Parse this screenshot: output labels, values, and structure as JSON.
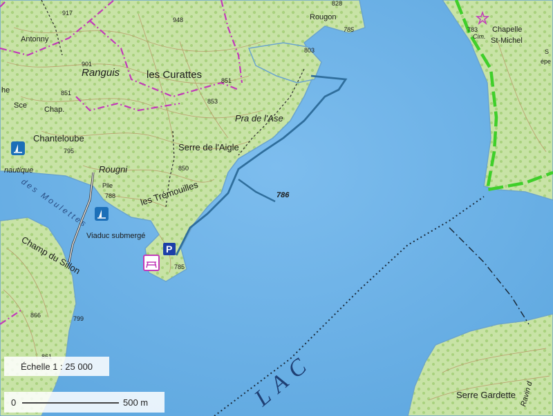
{
  "map": {
    "places": {
      "antonny": "Antonny",
      "ranguis": "Ranguis",
      "curattes": "les Curattes",
      "pra_de_lase": "Pra de l'Ase",
      "serre_aigle": "Serre de l'Aigle",
      "chanteloube": "Chanteloube",
      "rougni": "Rougni",
      "plle": "Plle",
      "tremouilles": "les Trémouilles",
      "viaduc": "Viaduc submergé",
      "champ_du_sillon": "Champ du Sillon",
      "rougon": "Rougon",
      "chap": "Chap.",
      "sce": "Sce",
      "nautique": "nautique",
      "he": "he",
      "chapelle": "Chapelle",
      "st_michel": "St-Michel",
      "cim": "Cim.",
      "serre_gardette": "Serre Gardette",
      "ravin": "Ravin d",
      "lac": "L A C",
      "moulettes": "des Moulettes",
      "se": "S",
      "epe": "épe"
    },
    "elevations": [
      "917",
      "948",
      "828",
      "785",
      "803",
      "901",
      "851",
      "853",
      "851",
      "795",
      "850",
      "788",
      "786",
      "785",
      "783",
      "799",
      "866",
      "861"
    ],
    "colors": {
      "water": "#6db2e6",
      "land": "#c8e3a6",
      "forest": "#b7d98f",
      "contour": "#b99565",
      "boundary": "#c23ab9",
      "park_boundary": "#3fcf2a",
      "trail": "#2f6e9c"
    },
    "icons": [
      "sailing-icon",
      "parking-icon",
      "picnic-icon",
      "chapel-icon"
    ]
  },
  "scale": {
    "ratio_label": "Échelle 1 : 25 000",
    "start_label": "0",
    "end_label": "500 m"
  }
}
